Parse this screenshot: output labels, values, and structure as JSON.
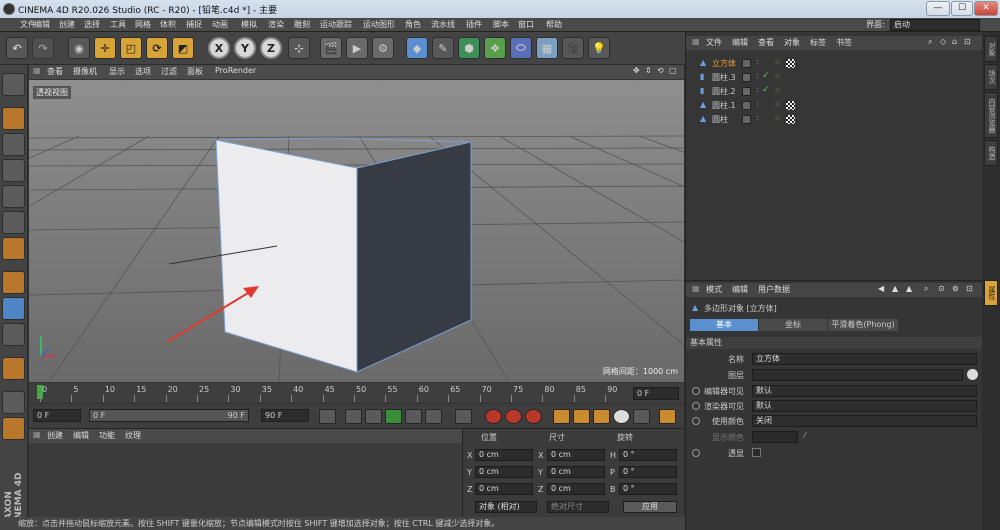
{
  "title": "CINEMA 4D R20.026 Studio (RC - R20) - [铅笔.c4d *] - 主要",
  "window_buttons": [
    "—",
    "☐",
    "✕"
  ],
  "layout_label": "界面:",
  "layout_value": "启动",
  "menu": [
    "文件",
    "编辑",
    "创建",
    "选择",
    "工具",
    "网格",
    "体积",
    "捕捉",
    "动画",
    "模拟",
    "渲染",
    "雕刻",
    "运动跟踪",
    "运动图形",
    "角色",
    "流水线",
    "插件",
    "脚本",
    "窗口",
    "帮助"
  ],
  "viewport": {
    "menu": [
      "查看",
      "摄像机",
      "显示",
      "选项",
      "过滤",
      "面板",
      "ProRender"
    ],
    "label": "透视视图",
    "grid_info": "网格间距：1000 cm"
  },
  "timeline": {
    "ticks": [
      "0",
      "5",
      "10",
      "15",
      "20",
      "25",
      "30",
      "35",
      "40",
      "45",
      "50",
      "55",
      "60",
      "65",
      "70",
      "75",
      "80",
      "85",
      "90"
    ],
    "frame_field": "0 F",
    "start": "0 F",
    "range_start": "0 F",
    "range_end": "90 F",
    "end": "90 F"
  },
  "material": {
    "menu": [
      "创建",
      "编辑",
      "功能",
      "纹理"
    ]
  },
  "coords": {
    "headers": [
      "位置",
      "尺寸",
      "旋转"
    ],
    "rows": [
      {
        "a": "X",
        "av": "0 cm",
        "b": "X",
        "bv": "0 cm",
        "c": "H",
        "cv": "0 °"
      },
      {
        "a": "Y",
        "av": "0 cm",
        "b": "Y",
        "bv": "0 cm",
        "c": "P",
        "cv": "0 °"
      },
      {
        "a": "Z",
        "av": "0 cm",
        "b": "Z",
        "bv": "0 cm",
        "c": "B",
        "cv": "0 °"
      }
    ],
    "mode": "对象 (相对)",
    "size_mode": "绝对尺寸",
    "apply": "应用"
  },
  "status": "缩放：点击并拖动鼠标缩放元素。按住 SHIFT 键量化缩放；节点编辑模式时按住 SHIFT 键增加选择对象；按住 CTRL 键减少选择对象。",
  "objects": {
    "menu": [
      "文件",
      "编辑",
      "查看",
      "对象",
      "标签",
      "书签"
    ],
    "items": [
      {
        "name": "立方体",
        "active": true
      },
      {
        "name": "圆柱.3",
        "active": false
      },
      {
        "name": "圆柱.2",
        "active": false
      },
      {
        "name": "圆柱.1",
        "active": false
      },
      {
        "name": "圆柱",
        "active": false
      }
    ]
  },
  "attributes": {
    "menu": [
      "模式",
      "编辑",
      "用户数据"
    ],
    "object_title": "多边形对象 [立方体]",
    "tabs": [
      "基本",
      "坐标",
      "平滑着色(Phong)"
    ],
    "section": "基本属性",
    "name_label": "名称",
    "name_value": "立方体",
    "layer_label": "图层",
    "editor_vis_label": "编辑器可见",
    "editor_vis_value": "默认",
    "render_vis_label": "渲染器可见",
    "render_vis_value": "默认",
    "use_color_label": "使用颜色",
    "use_color_value": "关闭",
    "display_color_label": "显示颜色",
    "xray_label": "透显"
  },
  "side_tabs": [
    "对象",
    "场次",
    "内容浏览器",
    "构造",
    "属性"
  ],
  "left_brand": "MAXON CINEMA 4D",
  "colors": {
    "accent": "#d9a437",
    "selected_tab": "#5a8fd0",
    "active_object": "#f0a030"
  }
}
